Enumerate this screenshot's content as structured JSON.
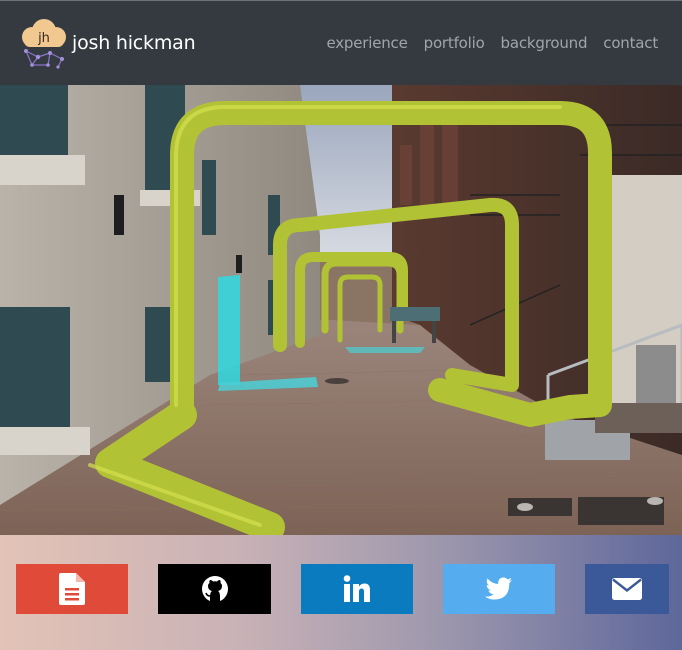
{
  "navbar": {
    "logo_initials": "jh",
    "brand_name": "josh hickman",
    "links": [
      {
        "label": "experience"
      },
      {
        "label": "portfolio"
      },
      {
        "label": "background"
      },
      {
        "label": "contact"
      }
    ]
  },
  "social": {
    "buttons": [
      {
        "icon": "document-icon",
        "color": "#df4b38"
      },
      {
        "icon": "github-icon",
        "color": "#000000"
      },
      {
        "icon": "linkedin-icon",
        "color": "#0a7bbf"
      },
      {
        "icon": "twitter-icon",
        "color": "#55acee"
      },
      {
        "icon": "envelope-icon",
        "color": "#3b5998"
      }
    ]
  },
  "colors": {
    "navbar_bg": "#343a40",
    "nav_link": "#9fa5ab",
    "sculpture_green": "#b2c235"
  }
}
